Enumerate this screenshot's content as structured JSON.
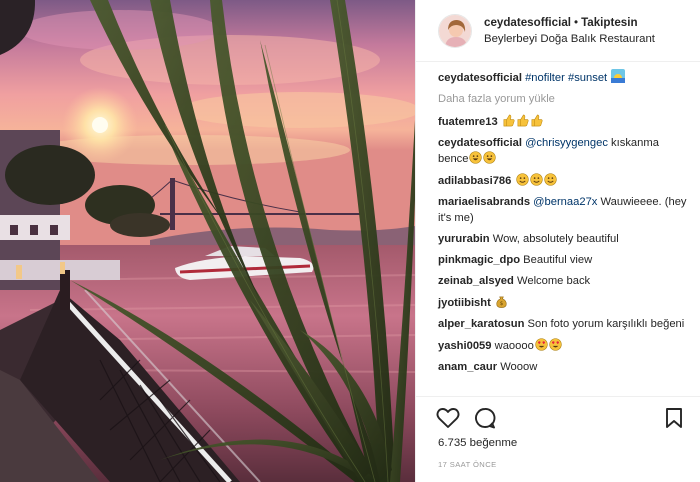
{
  "post": {
    "author": "ceydatesofficial",
    "separator": "•",
    "follow_status": "Takiptesin",
    "location": "Beylerbeyi Doğa Balık Restaurant"
  },
  "caption": {
    "user": "ceydatesofficial",
    "text": "#nofilter #sunset",
    "emoji": "sunset-icon"
  },
  "load_more": "Daha fazla yorum yükle",
  "comments": [
    {
      "user": "fuatemre13",
      "text": "",
      "emoji": [
        "thumbs-up",
        "thumbs-up",
        "thumbs-up"
      ]
    },
    {
      "user": "ceydatesofficial",
      "mention": "@chrisyygengec",
      "text": "kıskanma bence",
      "emoji": [
        "grin",
        "grin"
      ]
    },
    {
      "user": "adilabbasi786",
      "text": "",
      "emoji": [
        "smile",
        "smile",
        "smile"
      ]
    },
    {
      "user": "mariaelisabrands",
      "mention": "@bernaa27x",
      "text": "Wauwieeee. (hey it's me)",
      "emoji": []
    },
    {
      "user": "yururabin",
      "text": "Wow, absolutely beautiful",
      "emoji": []
    },
    {
      "user": "pinkmagic_dpo",
      "text": "Beautiful view",
      "emoji": []
    },
    {
      "user": "zeinab_alsyed",
      "text": "Welcome back",
      "emoji": []
    },
    {
      "user": "jyotiibisht",
      "text": "",
      "emoji": [
        "money-bag"
      ]
    },
    {
      "user": "alper_karatosun",
      "text": "Son foto yorum karşılıklı beğeni",
      "emoji": []
    },
    {
      "user": "yashi0059",
      "text": "waoooo",
      "emoji": [
        "heart-eyes",
        "heart-eyes"
      ]
    },
    {
      "user": "anam_caur",
      "text": "Wooow",
      "emoji": []
    }
  ],
  "actions": {
    "like_icon": "heart-icon",
    "comment_icon": "comment-icon",
    "save_icon": "bookmark-icon"
  },
  "likes_text": "6.735 beğenme",
  "timestamp": "17 SAAT ÖNCE",
  "colors": {
    "text": "#262626",
    "mention": "#003569",
    "muted": "#999999",
    "border": "#efefef"
  }
}
